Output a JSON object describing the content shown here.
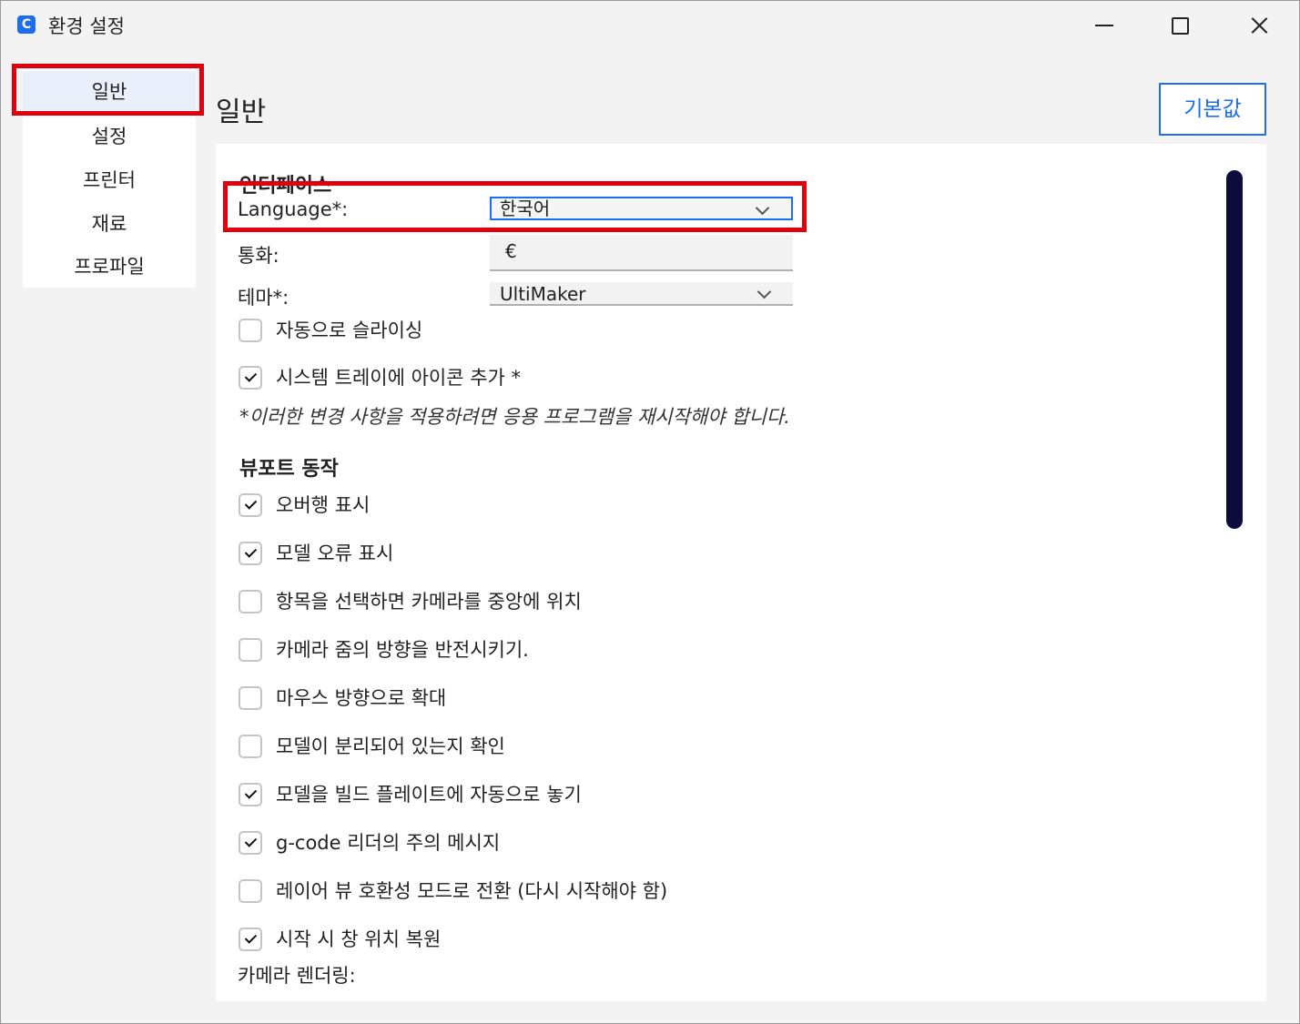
{
  "window": {
    "title": "환경 설정",
    "app_icon": "C"
  },
  "sidebar": {
    "items": [
      {
        "label": "일반",
        "active": true
      },
      {
        "label": "설정"
      },
      {
        "label": "프린터"
      },
      {
        "label": "재료"
      },
      {
        "label": "프로파일"
      }
    ]
  },
  "main": {
    "title": "일반",
    "defaults_button": "기본값",
    "interface": {
      "section_title": "인터페이스",
      "language_label": "Language*:",
      "language_value": "한국어",
      "currency_label": "통화:",
      "currency_value": "€",
      "theme_label": "테마*:",
      "theme_value": "UltiMaker",
      "checks": [
        {
          "label": "자동으로 슬라이싱",
          "checked": false
        },
        {
          "label": "시스템 트레이에 아이콘 추가 *",
          "checked": true
        }
      ],
      "restart_note": "*이러한 변경 사항을 적용하려면 응용 프로그램을 재시작해야 합니다."
    },
    "viewport": {
      "section_title": "뷰포트 동작",
      "checks": [
        {
          "label": "오버행 표시",
          "checked": true
        },
        {
          "label": "모델 오류 표시",
          "checked": true
        },
        {
          "label": "항목을 선택하면 카메라를 중앙에 위치",
          "checked": false
        },
        {
          "label": "카메라 줌의 방향을 반전시키기.",
          "checked": false
        },
        {
          "label": "마우스 방향으로 확대",
          "checked": false
        },
        {
          "label": "모델이 분리되어 있는지 확인",
          "checked": false
        },
        {
          "label": "모델을 빌드 플레이트에 자동으로 놓기",
          "checked": true
        },
        {
          "label": "g-code 리더의 주의 메시지",
          "checked": true
        },
        {
          "label": "레이어 뷰 호환성 모드로 전환 (다시 시작해야 함)",
          "checked": false
        },
        {
          "label": "시작 시 창 위치 복원",
          "checked": true
        }
      ],
      "camera_rendering_label": "카메라 렌더링:"
    }
  },
  "colors": {
    "accent": "#1b6ef2",
    "highlight": "#e0000d",
    "scrollbar": "#0d0c3d"
  }
}
